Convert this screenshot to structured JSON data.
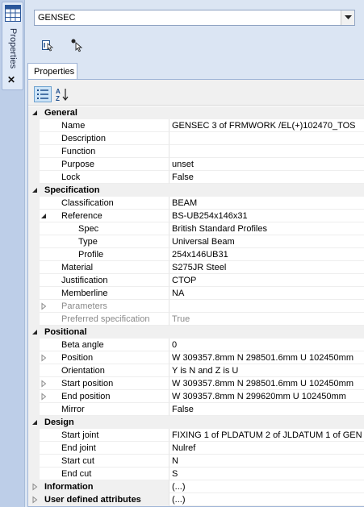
{
  "dock": {
    "label": "Properties",
    "close_glyph": "✕"
  },
  "element_selector": {
    "value": "GENSEC"
  },
  "tab": {
    "label": "Properties"
  },
  "categories": [
    {
      "label": "General",
      "expanded": true,
      "rows": [
        {
          "label": "Name",
          "value": "GENSEC 3 of FRMWORK /EL(+)102470_TOS"
        },
        {
          "label": "Description",
          "value": ""
        },
        {
          "label": "Function",
          "value": ""
        },
        {
          "label": "Purpose",
          "value": "unset"
        },
        {
          "label": "Lock",
          "value": "False"
        }
      ]
    },
    {
      "label": "Specification",
      "expanded": true,
      "rows": [
        {
          "label": "Classification",
          "value": "BEAM"
        },
        {
          "label": "Reference",
          "value": "BS-UB254x146x31",
          "expander": "expanded",
          "children": [
            {
              "label": "Spec",
              "value": "British Standard Profiles"
            },
            {
              "label": "Type",
              "value": "Universal Beam"
            },
            {
              "label": "Profile",
              "value": "254x146UB31"
            }
          ]
        },
        {
          "label": "Material",
          "value": "S275JR Steel"
        },
        {
          "label": "Justification",
          "value": "CTOP"
        },
        {
          "label": "Memberline",
          "value": "NA"
        },
        {
          "label": "Parameters",
          "value": "",
          "expander": "collapsed",
          "disabled": true
        },
        {
          "label": "Preferred specification",
          "value": "True",
          "disabled": true
        }
      ]
    },
    {
      "label": "Positional",
      "expanded": true,
      "rows": [
        {
          "label": "Beta angle",
          "value": "0"
        },
        {
          "label": "Position",
          "value": "W 309357.8mm N 298501.6mm U 102450mm",
          "expander": "collapsed"
        },
        {
          "label": "Orientation",
          "value": "Y is N and Z is U"
        },
        {
          "label": "Start position",
          "value": "W 309357.8mm N 298501.6mm U 102450mm",
          "expander": "collapsed"
        },
        {
          "label": "End position",
          "value": "W 309357.8mm N 299620mm U 102450mm",
          "expander": "collapsed"
        },
        {
          "label": "Mirror",
          "value": "False"
        }
      ]
    },
    {
      "label": "Design",
      "expanded": true,
      "rows": [
        {
          "label": "Start joint",
          "value": "FIXING 1 of PLDATUM 2 of JLDATUM 1 of GEN"
        },
        {
          "label": "End joint",
          "value": "Nulref"
        },
        {
          "label": "Start cut",
          "value": "N"
        },
        {
          "label": "End cut",
          "value": "S"
        }
      ]
    },
    {
      "label": "Information",
      "expanded": false,
      "value": "(...)",
      "rows": []
    },
    {
      "label": "User defined attributes",
      "expanded": false,
      "value": "(...)",
      "rows": []
    }
  ],
  "colors": {
    "dock_bg": "#bdcee8",
    "panel_bg": "#dbe5f3",
    "category_bg": "#f0f0f0"
  },
  "icons": [
    "table-icon",
    "close-icon",
    "dropdown-arrow-icon",
    "navigate-up-icon",
    "pick-element-icon",
    "categorized-view-icon",
    "sort-alphabetical-icon",
    "expand-arrow-icon",
    "collapse-arrow-icon"
  ]
}
